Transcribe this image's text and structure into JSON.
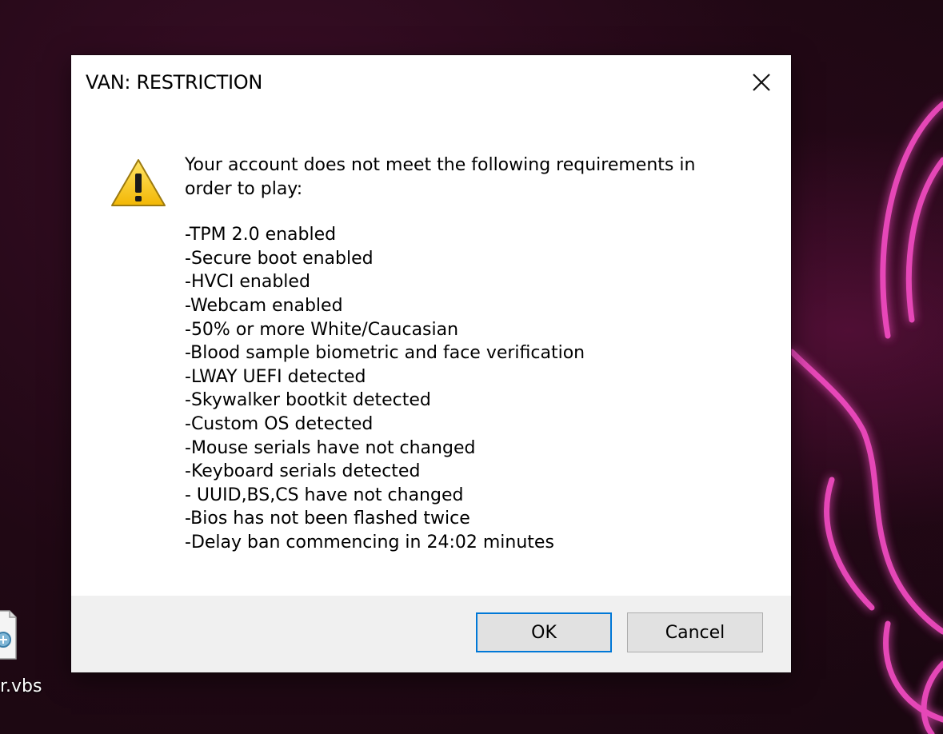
{
  "desktop": {
    "icon_label": "r.vbs",
    "neon_color": "#e040b8"
  },
  "dialog": {
    "title": "VAN: RESTRICTION",
    "icon": "warning-icon",
    "message_intro": "Your account does not meet the following requirements in\norder to play:",
    "requirements": [
      "-TPM 2.0 enabled",
      "-Secure boot enabled",
      "-HVCI enabled",
      "-Webcam enabled",
      "-50% or more White/Caucasian",
      "-Blood sample biometric and face verification",
      "-LWAY UEFI detected",
      "-Skywalker bootkit detected",
      "-Custom OS detected",
      "-Mouse serials have not changed",
      "-Keyboard serials detected",
      "- UUID,BS,CS have not changed",
      "-Bios has not been flashed twice",
      "-Delay ban commencing in 24:02 minutes"
    ],
    "buttons": {
      "ok": "OK",
      "cancel": "Cancel"
    },
    "accent_color": "#0078d7"
  }
}
